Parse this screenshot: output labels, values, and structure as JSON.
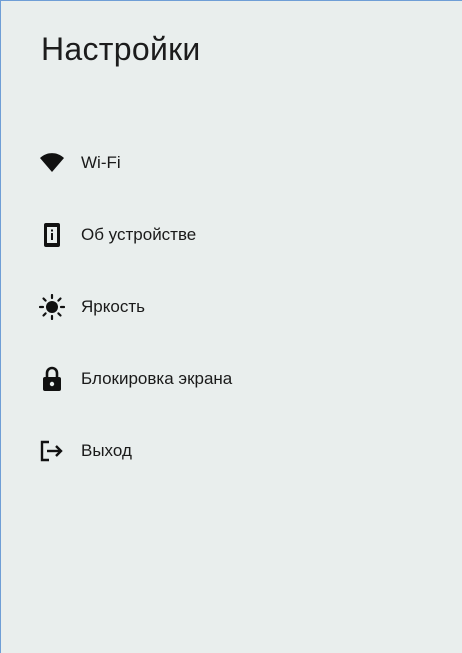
{
  "page": {
    "title": "Настройки"
  },
  "menu": {
    "items": [
      {
        "label": "Wi-Fi",
        "icon": "wifi-icon"
      },
      {
        "label": "Об устройстве",
        "icon": "device-info-icon"
      },
      {
        "label": "Яркость",
        "icon": "brightness-icon"
      },
      {
        "label": "Блокировка экрана",
        "icon": "lock-icon"
      },
      {
        "label": "Выход",
        "icon": "logout-icon"
      }
    ]
  },
  "colors": {
    "background": "#e9eeed",
    "text": "#1a1a1a",
    "border": "#6f9ed6"
  }
}
